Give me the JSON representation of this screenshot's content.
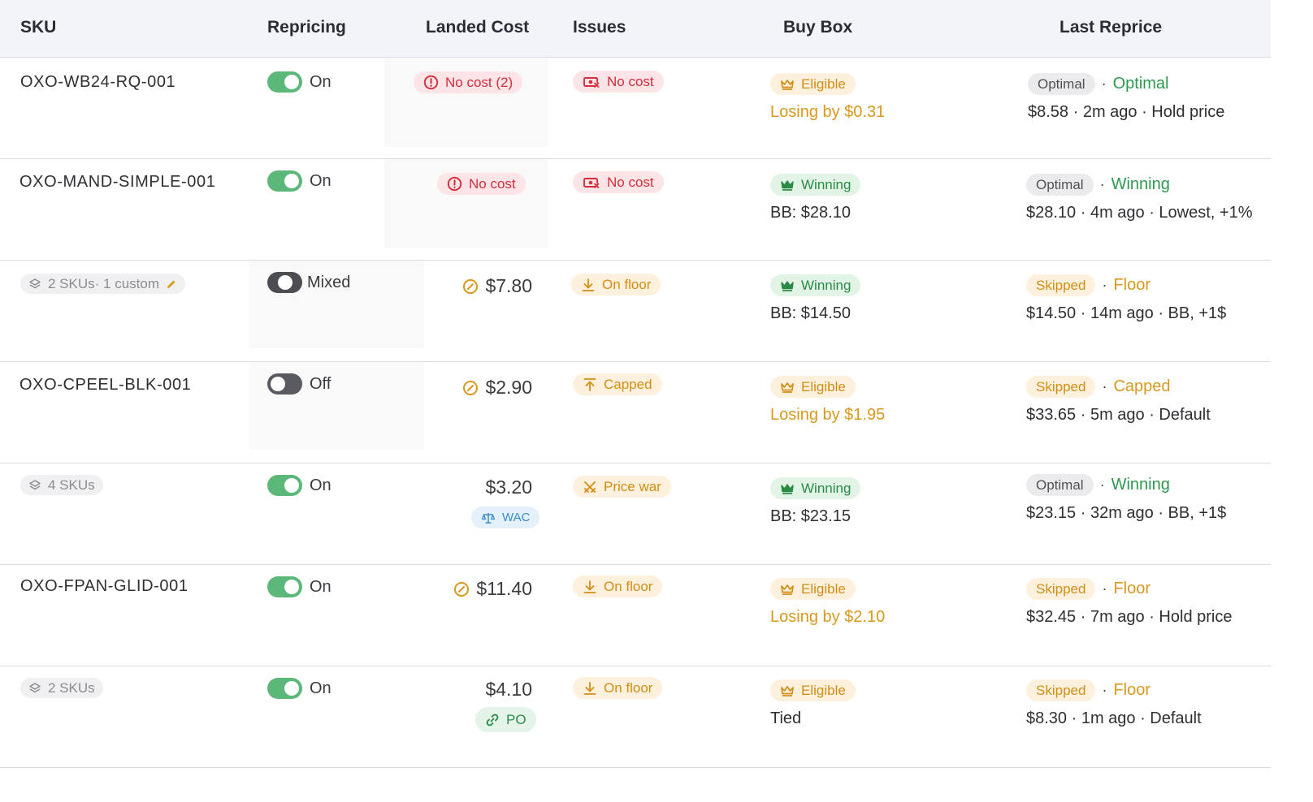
{
  "columns": {
    "sku": "SKU",
    "repricing": "Repricing",
    "landed_cost": "Landed Cost",
    "issues": "Issues",
    "buy_box": "Buy Box",
    "last_reprice": "Last Reprice"
  },
  "rows": [
    {
      "sku": "OXO-WB24-RQ-001",
      "repricing": "On",
      "landed_cost_badge": "No cost (2)",
      "issue": "No cost",
      "buybox_status": "Eligible",
      "buybox_detail": "Losing by $0.31",
      "reprice_badge": "Optimal",
      "reprice_status": "Optimal",
      "reprice_detail": "$8.58 · 2m ago · Hold price"
    },
    {
      "sku": "OXO-MAND-SIMPLE-001",
      "repricing": "On",
      "landed_cost_badge": "No cost",
      "issue": "No cost",
      "buybox_status": "Winning",
      "buybox_detail": "BB: $28.10",
      "reprice_badge": "Optimal",
      "reprice_status": "Winning",
      "reprice_detail": "$28.10 · 4m ago · Lowest, +1%"
    },
    {
      "sku_chip": "2 SKUs· 1 custom",
      "repricing": "Mixed",
      "landed_cost": "$7.80",
      "issue": "On floor",
      "buybox_status": "Winning",
      "buybox_detail": "BB: $14.50",
      "reprice_badge": "Skipped",
      "reprice_status": "Floor",
      "reprice_detail": "$14.50 · 14m ago · BB, +1$"
    },
    {
      "sku": "OXO-CPEEL-BLK-001",
      "repricing": "Off",
      "landed_cost": "$2.90",
      "issue": "Capped",
      "buybox_status": "Eligible",
      "buybox_detail": "Losing by $1.95",
      "reprice_badge": "Skipped",
      "reprice_status": "Capped",
      "reprice_detail": "$33.65 · 5m ago · Default"
    },
    {
      "sku_chip": "4 SKUs",
      "repricing": "On",
      "landed_cost": "$3.20",
      "landed_cost_tag": "WAC",
      "issue": "Price war",
      "buybox_status": "Winning",
      "buybox_detail": "BB: $23.15",
      "reprice_badge": "Optimal",
      "reprice_status": "Winning",
      "reprice_detail": "$23.15 · 32m ago · BB, +1$"
    },
    {
      "sku": "OXO-FPAN-GLID-001",
      "repricing": "On",
      "landed_cost": "$11.40",
      "issue": "On floor",
      "buybox_status": "Eligible",
      "buybox_detail": "Losing by $2.10",
      "reprice_badge": "Skipped",
      "reprice_status": "Floor",
      "reprice_detail": "$32.45 · 7m ago · Hold price"
    },
    {
      "sku_chip": "2 SKUs",
      "repricing": "On",
      "landed_cost": "$4.10",
      "landed_cost_tag": "PO",
      "issue": "On floor",
      "buybox_status": "Eligible",
      "buybox_detail": "Tied",
      "reprice_badge": "Skipped",
      "reprice_status": "Floor",
      "reprice_detail": "$8.30 · 1m ago · Default"
    }
  ],
  "colors": {
    "header_bg": "#f3f4f8",
    "toggle_on": "#5cb879",
    "toggle_off": "#5a5b60",
    "red": "#d42d3c",
    "amber": "#d9981e",
    "green": "#2d9850",
    "blue": "#3a8ccc"
  },
  "icons": {
    "sku_chip": "layers-icon",
    "custom": "pencil-icon",
    "no_cost_badge": "alert-circle-icon",
    "no_cost_issue": "money-off-icon",
    "on_floor": "arrow-down-to-line-icon",
    "capped": "arrow-up-from-line-icon",
    "price_war": "crossed-swords-icon",
    "buybox": "crown-icon",
    "cost_warning": "slash-circle-icon",
    "wac": "scale-icon",
    "po": "link-icon"
  }
}
